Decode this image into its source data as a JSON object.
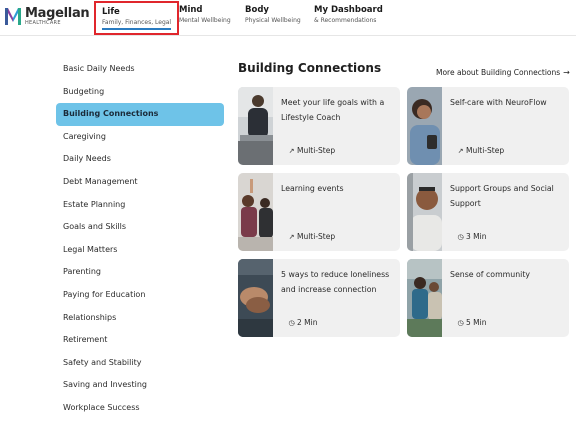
{
  "brand": {
    "name": "Magellan",
    "sub": "HEALTHCARE"
  },
  "nav": [
    {
      "title": "Life",
      "sub": "Family, Finances, Legal",
      "active": true
    },
    {
      "title": "Mind",
      "sub": "Mental Wellbeing"
    },
    {
      "title": "Body",
      "sub": "Physical Wellbeing"
    },
    {
      "title": "My Dashboard",
      "sub": "& Recommendations"
    }
  ],
  "sidebar": {
    "items": [
      {
        "label": "Basic Daily Needs"
      },
      {
        "label": "Budgeting"
      },
      {
        "label": "Building Connections",
        "active": true
      },
      {
        "label": "Caregiving"
      },
      {
        "label": "Daily Needs"
      },
      {
        "label": "Debt Management"
      },
      {
        "label": "Estate Planning"
      },
      {
        "label": "Goals and Skills"
      },
      {
        "label": "Legal Matters"
      },
      {
        "label": "Parenting"
      },
      {
        "label": "Paying for Education"
      },
      {
        "label": "Relationships"
      },
      {
        "label": "Retirement"
      },
      {
        "label": "Safety and Stability"
      },
      {
        "label": "Saving and Investing"
      },
      {
        "label": "Workplace Success"
      }
    ]
  },
  "main": {
    "title": "Building Connections",
    "more_link": "More about Building Connections",
    "more_icon": "arrow-right-icon",
    "cards": [
      {
        "title": "Meet your life goals with a Lifestyle Coach",
        "meta": "Multi-Step",
        "meta_icon": "trend-icon"
      },
      {
        "title": "Self-care with NeuroFlow",
        "meta": "Multi-Step",
        "meta_icon": "trend-icon"
      },
      {
        "title": "Learning events",
        "meta": "Multi-Step",
        "meta_icon": "trend-icon"
      },
      {
        "title": "Support Groups and Social Support",
        "meta": "3 Min",
        "meta_icon": "clock-icon"
      },
      {
        "title": "5 ways to reduce loneliness and increase connection",
        "meta": "2 Min",
        "meta_icon": "clock-icon"
      },
      {
        "title": "Sense of community",
        "meta": "5 Min",
        "meta_icon": "clock-icon"
      }
    ]
  },
  "colors": {
    "active_sidebar": "#6ec3e8",
    "highlight_box": "#e0262c",
    "tab_underline": "#2a7bc0",
    "card_bg": "#f0f0f0"
  }
}
